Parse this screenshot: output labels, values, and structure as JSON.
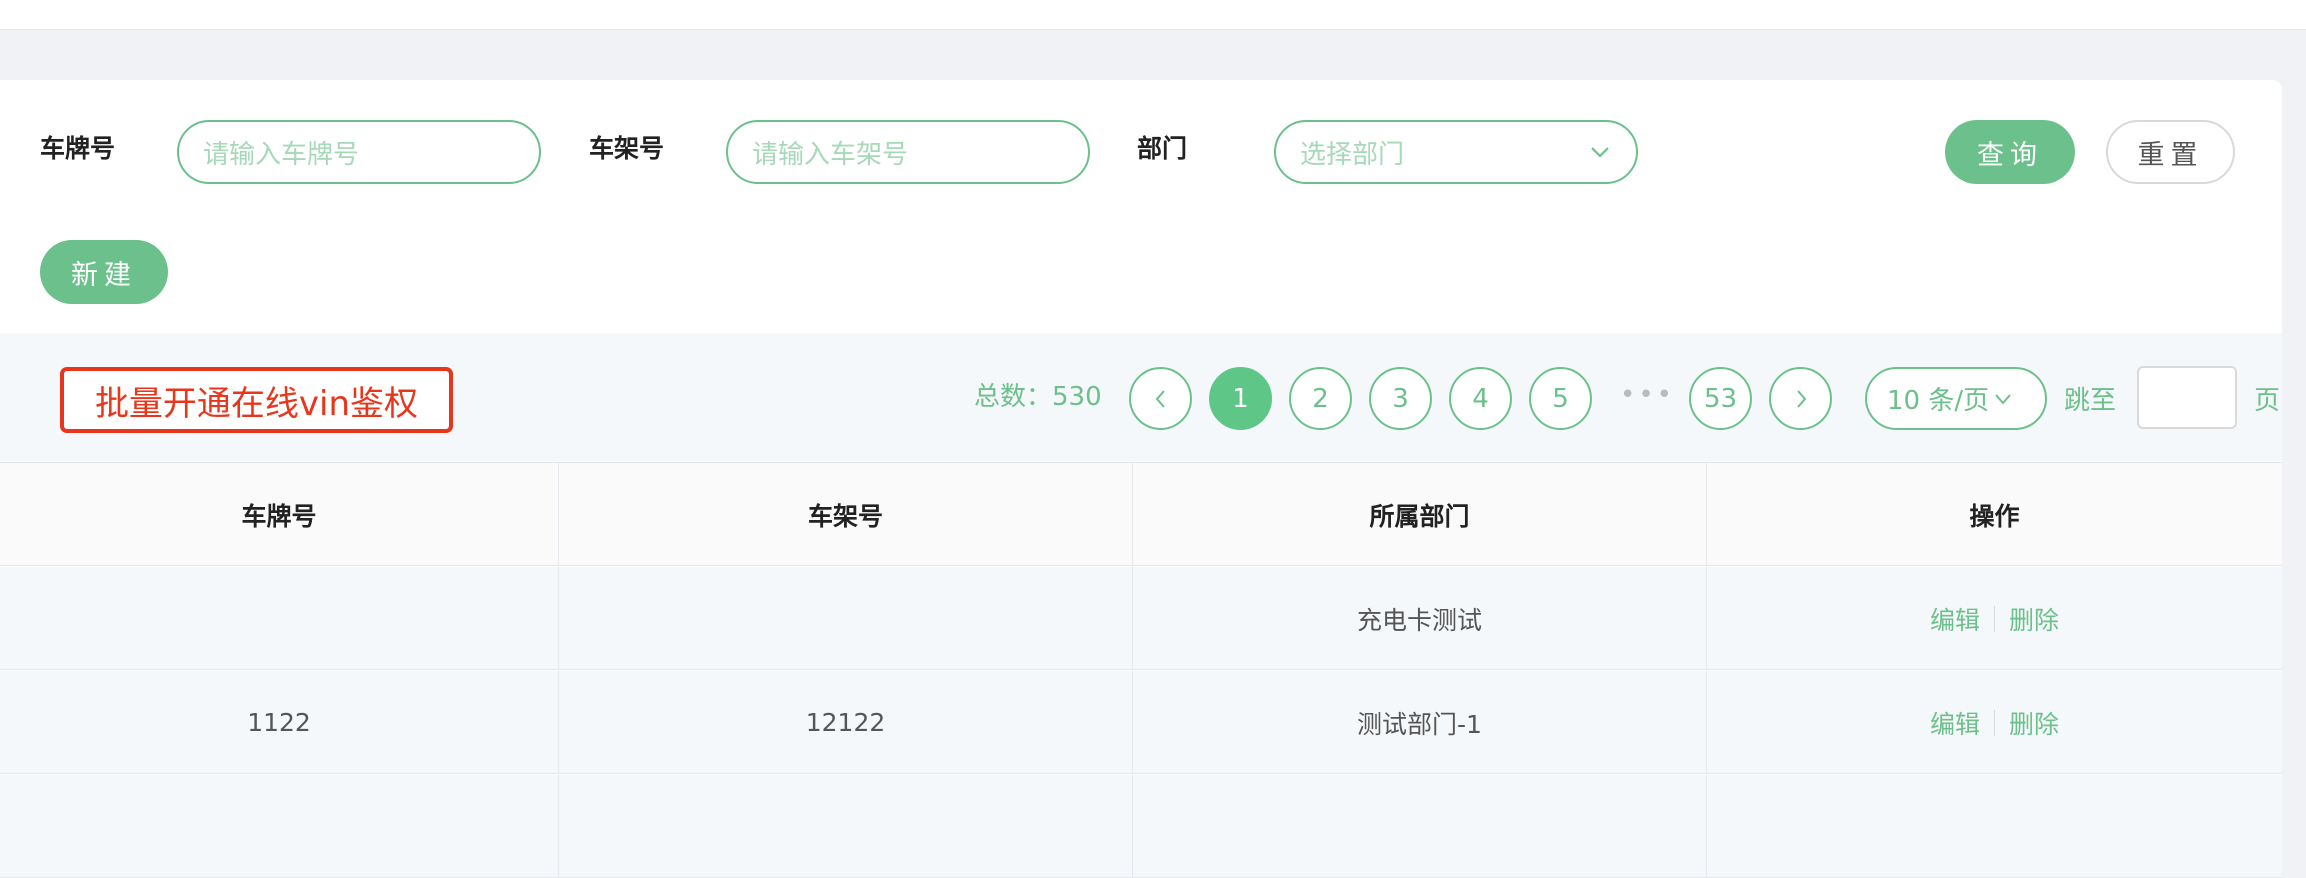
{
  "filters": {
    "plate_label": "车牌号",
    "plate_placeholder": "请输入车牌号",
    "vin_label": "车架号",
    "vin_placeholder": "请输入车架号",
    "dept_label": "部门",
    "dept_placeholder": "选择部门"
  },
  "buttons": {
    "query": "查询",
    "reset": "重置",
    "create": "新建"
  },
  "batch_action": "批量开通在线vin鉴权",
  "pagination": {
    "total_text": "总数：530",
    "pages": [
      "1",
      "2",
      "3",
      "4",
      "5"
    ],
    "current_page": "1",
    "ellipsis": "•••",
    "last_page": "53",
    "page_size": "10 条/页",
    "jump_label": "跳至",
    "page_suffix": "页"
  },
  "table": {
    "headers": [
      "车牌号",
      "车架号",
      "所属部门",
      "操作"
    ],
    "rows": [
      {
        "plate": "",
        "vin": "",
        "dept": "充电卡测试",
        "edit": "编辑",
        "delete": "删除"
      },
      {
        "plate": "1122",
        "vin": "12122",
        "dept": "测试部门-1",
        "edit": "编辑",
        "delete": "删除"
      }
    ]
  },
  "colors": {
    "accent": "#6cc08b",
    "active_page": "#5ec788",
    "highlight_border": "#e8361c"
  }
}
